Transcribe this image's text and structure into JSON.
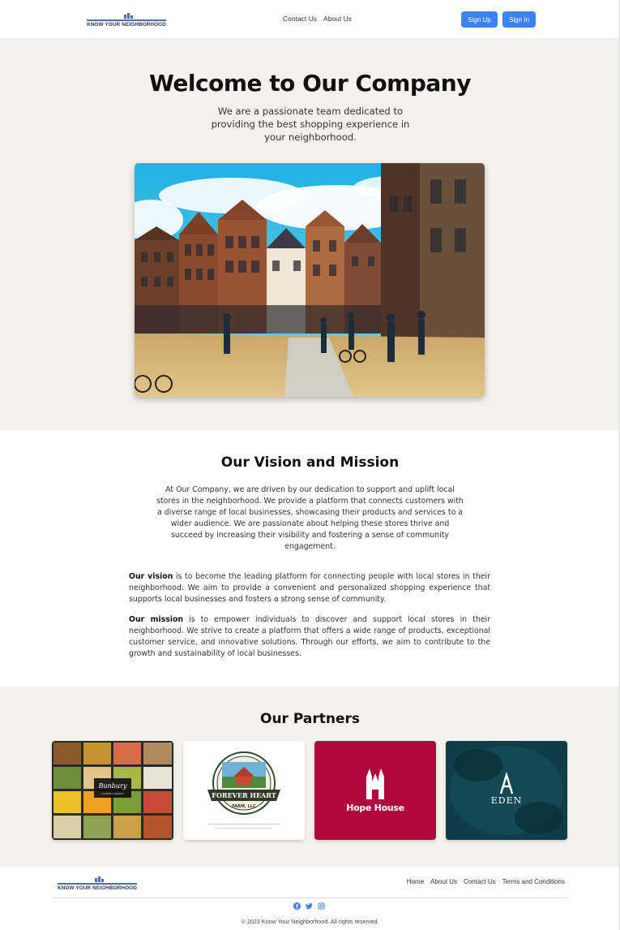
{
  "brand": {
    "name": "KNOW YOUR NEIGHBORHOOD",
    "accent": "#3b82f6"
  },
  "header": {
    "nav": [
      "Contact Us",
      "About Us"
    ],
    "signup_label": "Sign Up",
    "signin_label": "Sign In"
  },
  "hero": {
    "title": "Welcome to Our Company",
    "subtitle": "We are a passionate team dedicated to providing the best shopping experience in your neighborhood.",
    "bg": "#f5f1eb"
  },
  "vision": {
    "title": "Our Vision and Mission",
    "intro": "At Our Company, we are driven by our dedication to support and uplift local stores in the neighborhood. We provide a platform that connects customers with a diverse range of local businesses, showcasing their products and services to a wider audience. We are passionate about helping these stores thrive and succeed by increasing their visibility and fostering a sense of community engagement.",
    "vision_label": "Our vision",
    "vision_text": " is to become the leading platform for connecting people with local stores in their neighborhood. We aim to provide a convenient and personalized shopping experience that supports local businesses and fosters a strong sense of community.",
    "mission_label": "Our mission",
    "mission_text": " is to empower individuals to discover and support local stores in their neighborhood. We strive to create a platform that offers a wide range of products, exceptional customer service, and innovative solutions. Through our efforts, we aim to contribute to the growth and sustainability of local businesses."
  },
  "partners": {
    "title": "Our Partners",
    "cards": [
      {
        "name": "Bunbury",
        "sub": "FARMERS MARKET"
      },
      {
        "name": "FOREVER HEART",
        "sub": "FARM, LLC"
      },
      {
        "name": "Hope House"
      },
      {
        "name": "EDEN"
      }
    ]
  },
  "footer": {
    "nav": [
      "Home",
      "About Us",
      "Contact Us",
      "Terms and Conditions"
    ],
    "social_icons": [
      "facebook-icon",
      "twitter-icon",
      "instagram-icon"
    ],
    "copyright": "© 2023 Know Your Neighborhood. All rights reserved."
  }
}
